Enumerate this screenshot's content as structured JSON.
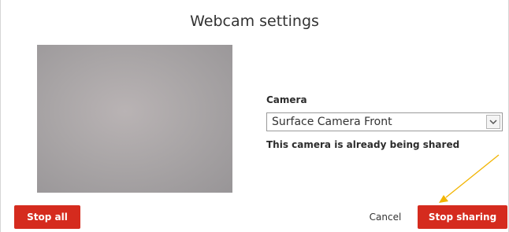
{
  "dialog": {
    "title": "Webcam settings"
  },
  "camera": {
    "label": "Camera",
    "selected": "Surface Camera Front",
    "status_text": "This camera is already being shared"
  },
  "buttons": {
    "stop_all": "Stop all",
    "cancel": "Cancel",
    "stop_sharing": "Stop sharing"
  },
  "colors": {
    "accent_red": "#d52b1e",
    "annotation_arrow": "#f2b400"
  }
}
